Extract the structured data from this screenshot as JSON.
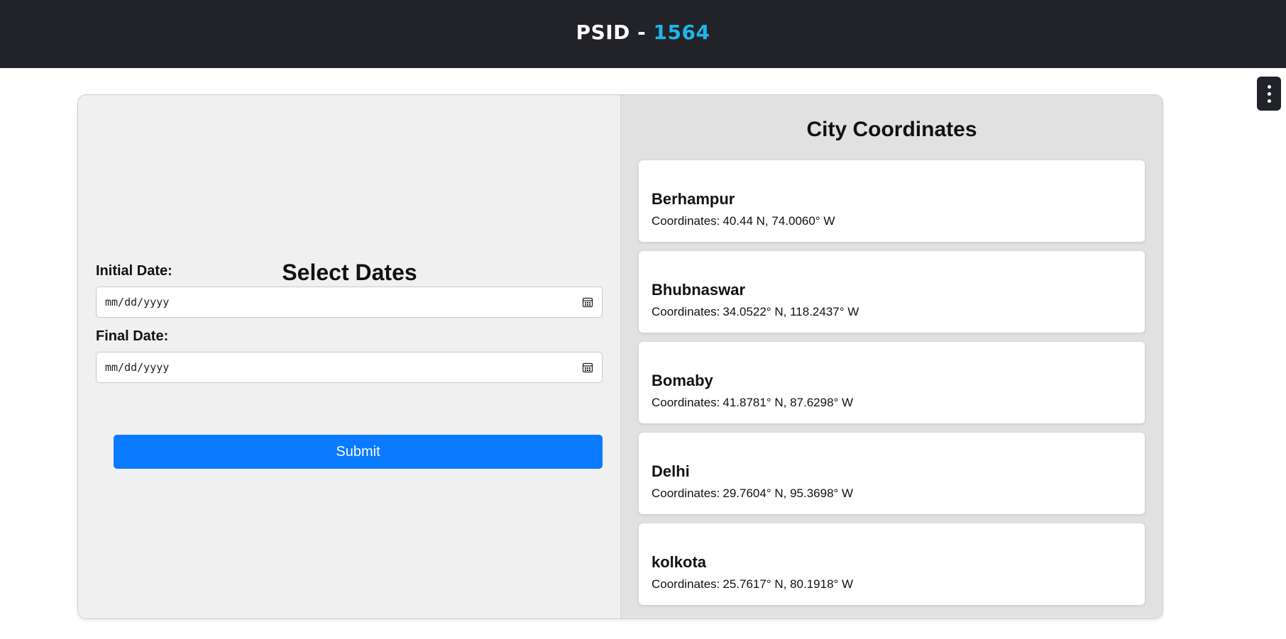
{
  "header": {
    "title_prefix": "PSID - ",
    "psid_number": "1564",
    "accent_color": "#1fb6e8",
    "background_color": "#222328"
  },
  "menu": {
    "icon": "kebab-vertical-icon"
  },
  "form": {
    "title": "Select Dates",
    "initial_label": "Initial Date:",
    "initial_placeholder": "mm/dd/yyyy",
    "final_label": "Final Date:",
    "final_placeholder": "mm/dd/yyyy",
    "submit_label": "Submit",
    "submit_color": "#0a7bff",
    "calendar_icon": "calendar-icon"
  },
  "coordinates": {
    "title": "City Coordinates",
    "coords_label": "Coordinates:",
    "cities": [
      {
        "name": "Berhampur",
        "coords": "40.44 N, 74.0060° W"
      },
      {
        "name": "Bhubnaswar",
        "coords": "34.0522° N, 118.2437° W"
      },
      {
        "name": "Bomaby",
        "coords": "41.8781° N, 87.6298° W"
      },
      {
        "name": "Delhi",
        "coords": "29.7604° N, 95.3698° W"
      },
      {
        "name": "kolkota",
        "coords": "25.7617° N, 80.1918° W"
      }
    ]
  }
}
